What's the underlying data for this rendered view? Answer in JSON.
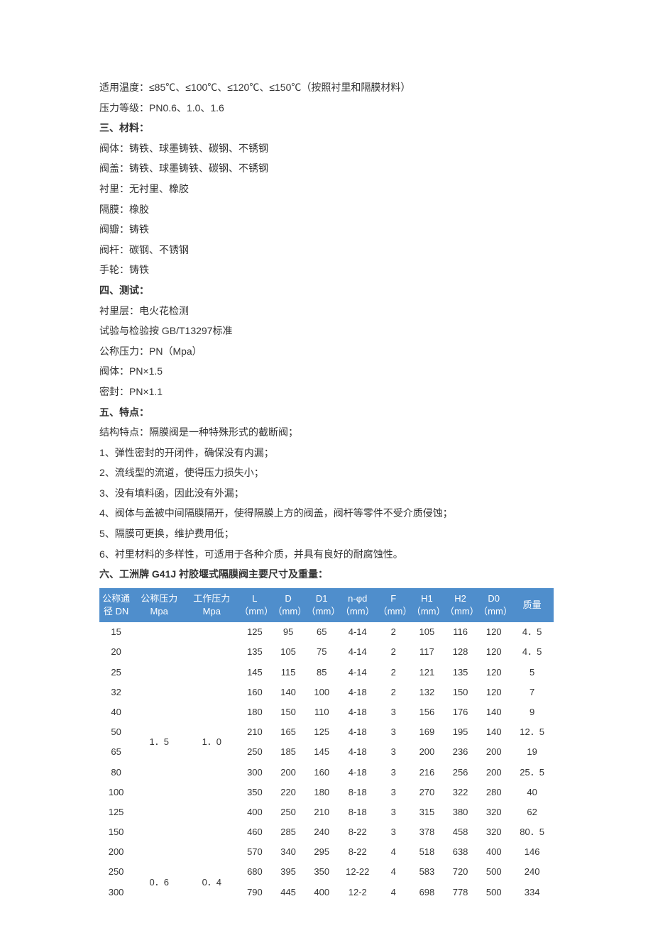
{
  "lines_top": [
    "适用温度：≤85℃、≤100℃、≤120℃、≤150℃（按照衬里和隔膜材料）",
    "压力等级：PN0.6、1.0、1.6"
  ],
  "section3_title": "三、材料：",
  "section3_lines": [
    "阀体：铸铁、球墨铸铁、碳钢、不锈钢",
    "阀盖：铸铁、球墨铸铁、碳钢、不锈钢",
    "衬里：无衬里、橡胶",
    "隔膜：橡胶",
    "阀瓣：铸铁",
    "阀杆：碳钢、不锈钢",
    "手轮：铸铁"
  ],
  "section4_title": "四、测试：",
  "section4_lines": [
    "衬里层：电火花检测",
    "试验与检验按 GB/T13297标准",
    "公称压力：PN（Mpa）",
    "阀体：PN×1.5",
    "密封：PN×1.1"
  ],
  "section5_title": "五、特点：",
  "section5_lines": [
    "结构特点：隔膜阀是一种特殊形式的截断阀；",
    "1、弹性密封的开闭件，确保没有内漏；",
    "2、流线型的流道，使得压力损失小；",
    "3、没有填料函，因此没有外漏；",
    "4、阀体与盖被中间隔膜隔开，使得隔膜上方的阀盖，阀杆等零件不受介质侵蚀；",
    "5、隔膜可更换，维护费用低；",
    "6、衬里材料的多样性，可适用于各种介质，并具有良好的耐腐蚀性。"
  ],
  "section6_title": "六、工洲牌 G41J 衬胶堰式隔膜阀主要尺寸及重量：",
  "chart_data": {
    "type": "table",
    "headers": {
      "dn": "公称通径 DN",
      "p_nom": "公称压力 Mpa",
      "p_work": "工作压力 Mpa",
      "L": "L （mm）",
      "D": "D （mm）",
      "D1": "D1 （mm）",
      "nphi": "n-φd （mm）",
      "F": "F （mm）",
      "H1": "H1 （mm）",
      "H2": "H2 （mm）",
      "D0": "D0 （mm）",
      "wt": "质量"
    },
    "groups": [
      {
        "p_nom": "1．5",
        "p_work": "1．0",
        "rows": [
          {
            "dn": "15",
            "L": "125",
            "D": "95",
            "D1": "65",
            "nphi": "4-14",
            "F": "2",
            "H1": "105",
            "H2": "116",
            "D0": "120",
            "wt": "4．5"
          },
          {
            "dn": "20",
            "L": "135",
            "D": "105",
            "D1": "75",
            "nphi": "4-14",
            "F": "2",
            "H1": "117",
            "H2": "128",
            "D0": "120",
            "wt": "4．5"
          },
          {
            "dn": "25",
            "L": "145",
            "D": "115",
            "D1": "85",
            "nphi": "4-14",
            "F": "2",
            "H1": "121",
            "H2": "135",
            "D0": "120",
            "wt": "5"
          },
          {
            "dn": "32",
            "L": "160",
            "D": "140",
            "D1": "100",
            "nphi": "4-18",
            "F": "2",
            "H1": "132",
            "H2": "150",
            "D0": "120",
            "wt": "7"
          },
          {
            "dn": "40",
            "L": "180",
            "D": "150",
            "D1": "110",
            "nphi": "4-18",
            "F": "3",
            "H1": "156",
            "H2": "176",
            "D0": "140",
            "wt": "9"
          },
          {
            "dn": "50",
            "L": "210",
            "D": "165",
            "D1": "125",
            "nphi": "4-18",
            "F": "3",
            "H1": "169",
            "H2": "195",
            "D0": "140",
            "wt": "12．5"
          },
          {
            "dn": "65",
            "L": "250",
            "D": "185",
            "D1": "145",
            "nphi": "4-18",
            "F": "3",
            "H1": "200",
            "H2": "236",
            "D0": "200",
            "wt": "19"
          },
          {
            "dn": "80",
            "L": "300",
            "D": "200",
            "D1": "160",
            "nphi": "4-18",
            "F": "3",
            "H1": "216",
            "H2": "256",
            "D0": "200",
            "wt": "25．5"
          },
          {
            "dn": "100",
            "L": "350",
            "D": "220",
            "D1": "180",
            "nphi": "8-18",
            "F": "3",
            "H1": "270",
            "H2": "322",
            "D0": "280",
            "wt": "40"
          },
          {
            "dn": "125",
            "L": "400",
            "D": "250",
            "D1": "210",
            "nphi": "8-18",
            "F": "3",
            "H1": "315",
            "H2": "380",
            "D0": "320",
            "wt": "62"
          },
          {
            "dn": "150",
            "L": "460",
            "D": "285",
            "D1": "240",
            "nphi": "8-22",
            "F": "3",
            "H1": "378",
            "H2": "458",
            "D0": "320",
            "wt": "80．5"
          },
          {
            "dn": "200",
            "L": "570",
            "D": "340",
            "D1": "295",
            "nphi": "8-22",
            "F": "4",
            "H1": "518",
            "H2": "638",
            "D0": "400",
            "wt": "146"
          }
        ]
      },
      {
        "p_nom": "0．6",
        "p_work": "0．4",
        "rows": [
          {
            "dn": "250",
            "L": "680",
            "D": "395",
            "D1": "350",
            "nphi": "12-22",
            "F": "4",
            "H1": "583",
            "H2": "720",
            "D0": "500",
            "wt": "240"
          },
          {
            "dn": "300",
            "L": "790",
            "D": "445",
            "D1": "400",
            "nphi": "12-2",
            "F": "4",
            "H1": "698",
            "H2": "778",
            "D0": "500",
            "wt": "334"
          }
        ]
      }
    ]
  }
}
